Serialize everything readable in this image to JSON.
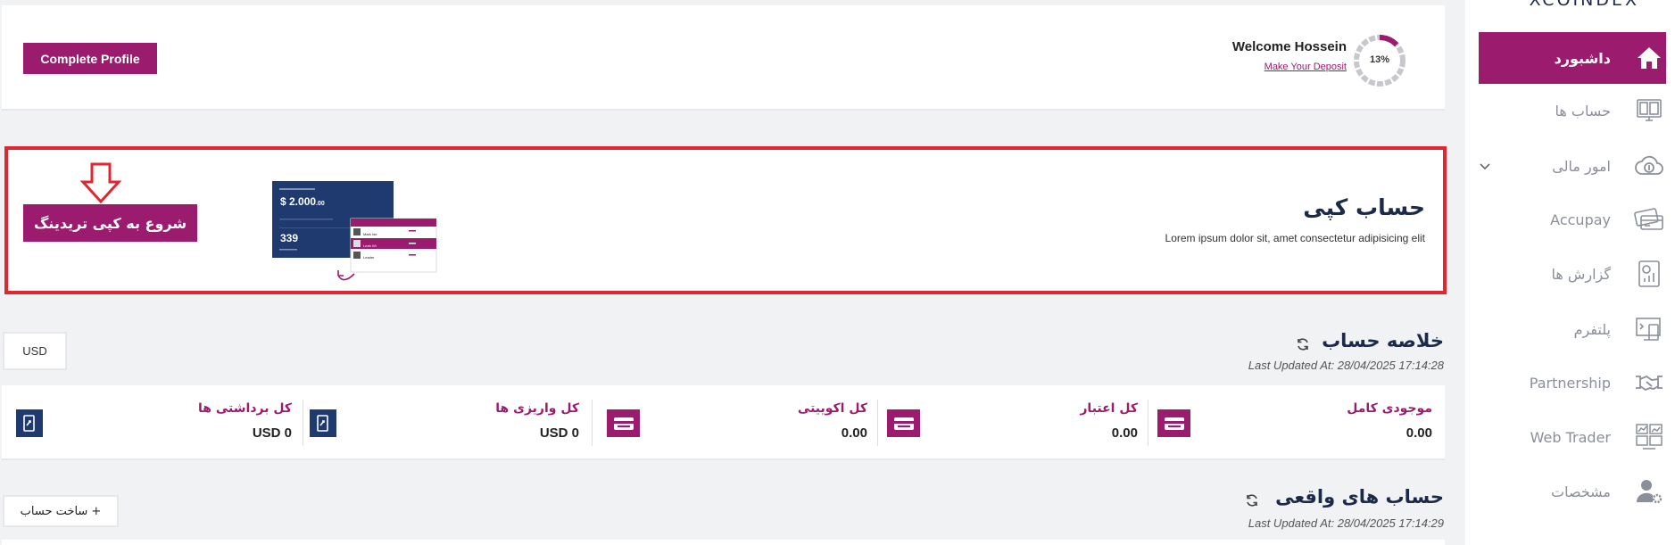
{
  "sidebar": {
    "brand": "XCOINDEX",
    "items": [
      {
        "label": "داشبورد",
        "icon": "home-icon"
      },
      {
        "label": "حساب ها",
        "icon": "accounts-icon"
      },
      {
        "label": "امور مالی",
        "icon": "finance-icon"
      },
      {
        "label": "Accupay",
        "icon": "cards-icon"
      },
      {
        "label": "گزارش ها",
        "icon": "report-icon"
      },
      {
        "label": "پلتفرم",
        "icon": "platform-icon"
      },
      {
        "label": "Partnership",
        "icon": "handshake-icon"
      },
      {
        "label": "Web Trader",
        "icon": "webtrader-icon"
      },
      {
        "label": "مشخصات",
        "icon": "profile-settings-icon"
      }
    ]
  },
  "welcome": {
    "button": "Complete Profile",
    "title": "Welcome Hossein",
    "link": "Make Your Deposit",
    "progress": "13%",
    "progress_value": 0.13
  },
  "copy": {
    "title": "حساب کپی",
    "subtitle": "Lorem ipsum dolor sit, amet consectetur adipisicing elit",
    "button": "شروع به کپی تریدینگ",
    "mock": {
      "balance": "$ 2.000",
      "balance_cents": ".00",
      "count": "339",
      "rows": [
        "Mark Ide",
        "Leah Wi",
        "Leader"
      ]
    }
  },
  "summary": {
    "title": "خلاصه حساب",
    "updated": "Last Updated At: 28/04/2025 17:14:28",
    "currency": "USD",
    "stats": [
      {
        "label": "موجودی کامل",
        "value": "0.00"
      },
      {
        "label": "کل اعتبار",
        "value": "0.00"
      },
      {
        "label": "کل اکوییتی",
        "value": "0.00"
      },
      {
        "label": "کل واریزی ها",
        "value": "USD 0"
      },
      {
        "label": "کل برداشتی ها",
        "value": "USD 0"
      }
    ]
  },
  "real_accounts": {
    "title": "حساب های واقعی",
    "updated": "Last Updated At: 28/04/2025 17:14:29",
    "create_button": "+ ساخت حساب"
  },
  "colors": {
    "brand": "#9b1b6e",
    "navy": "#1c2a4a",
    "highlight_border": "#e0262f"
  }
}
